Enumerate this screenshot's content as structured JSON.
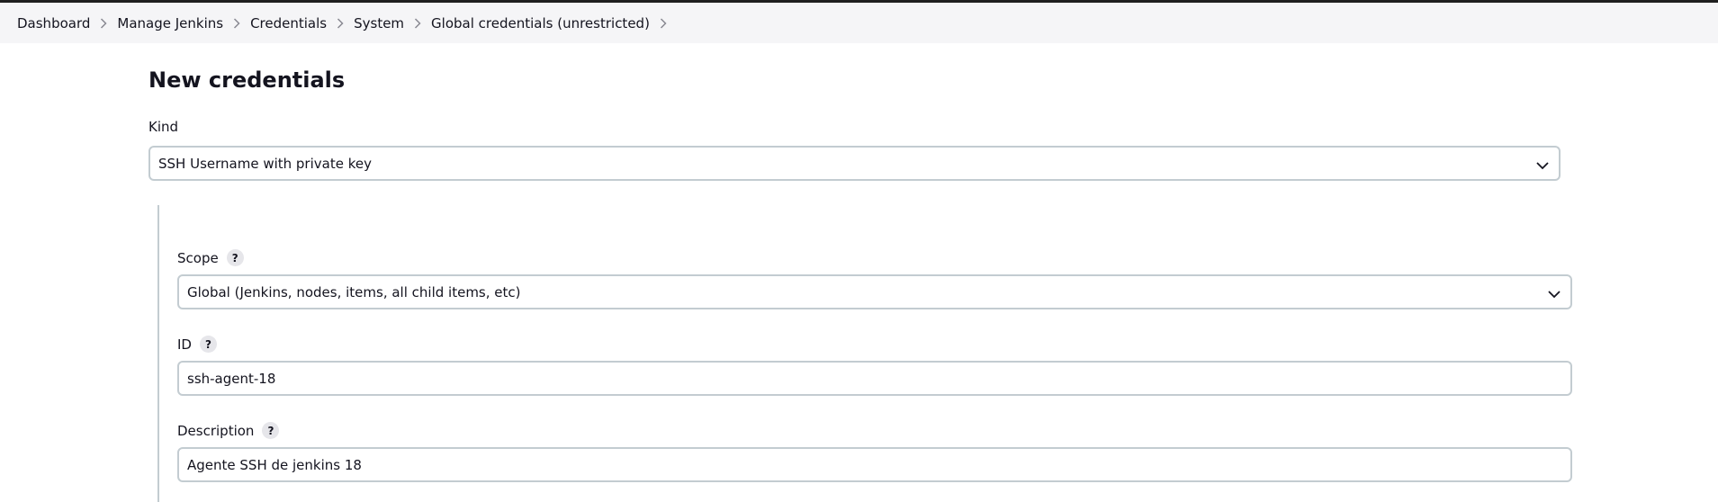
{
  "breadcrumb": {
    "items": [
      {
        "label": "Dashboard"
      },
      {
        "label": "Manage Jenkins"
      },
      {
        "label": "Credentials"
      },
      {
        "label": "System"
      },
      {
        "label": "Global credentials (unrestricted)"
      }
    ]
  },
  "page": {
    "title": "New credentials"
  },
  "form": {
    "kind": {
      "label": "Kind",
      "selected": "SSH Username with private key"
    },
    "scope": {
      "label": "Scope",
      "help": "?",
      "selected": "Global (Jenkins, nodes, items, all child items, etc)"
    },
    "id": {
      "label": "ID",
      "help": "?",
      "value": "ssh-agent-18"
    },
    "description": {
      "label": "Description",
      "help": "?",
      "value": "Agente SSH de jenkins 18"
    }
  },
  "colors": {
    "breadcrumb_bg": "#f5f5f7",
    "input_border": "#c3ccd1",
    "text": "#14141f",
    "help_badge_bg": "#e6e6ea"
  },
  "icons": {
    "breadcrumb_separator": "chevron-right-icon",
    "select_arrow": "chevron-down-icon",
    "help": "help-icon"
  }
}
